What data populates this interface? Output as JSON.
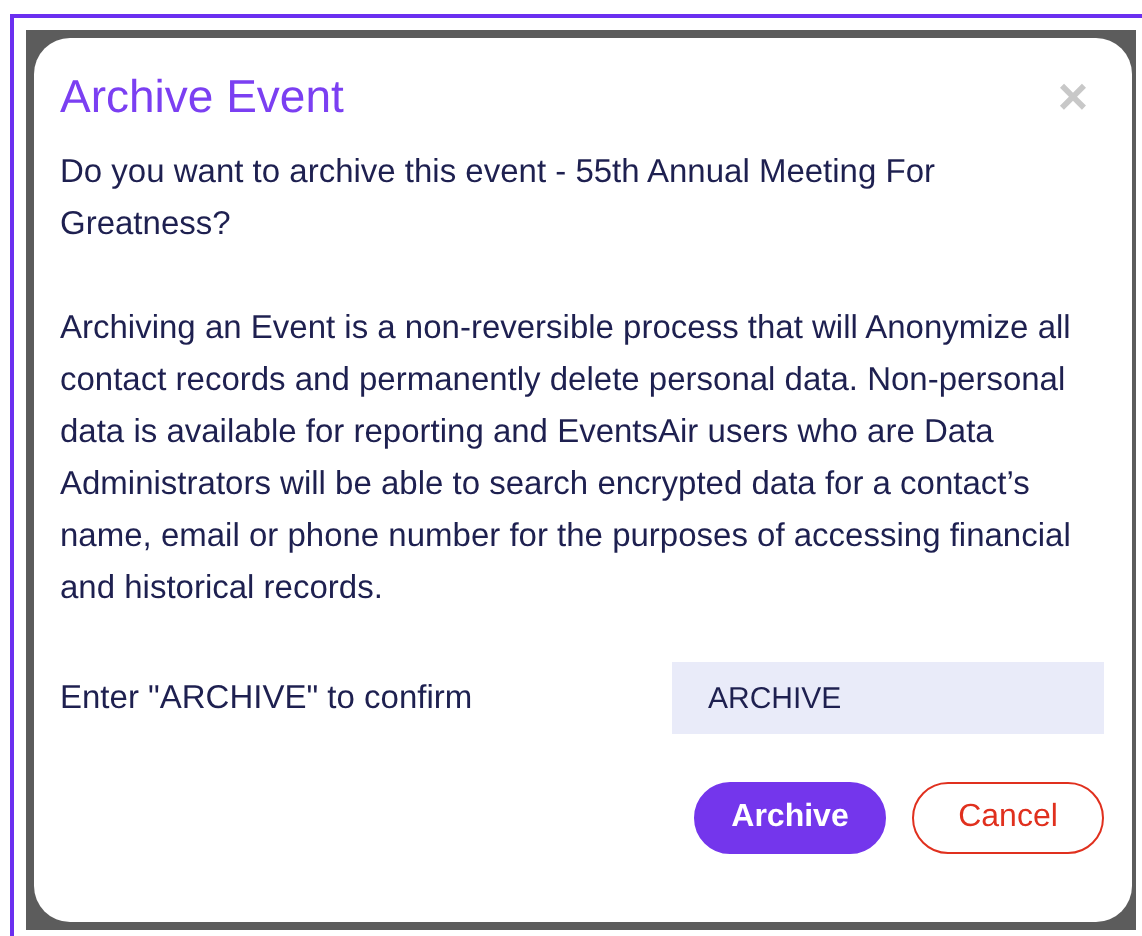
{
  "dialog": {
    "title": "Archive Event",
    "close": "×",
    "question": "Do you want to archive this event - 55th Annual Meeting For Greatness?",
    "description": "Archiving an Event is a non-reversible process that will Anonymize all contact records and permanently delete personal data. Non-personal data is available for reporting and EventsAir users who are Data Administrators will be able to search encrypted data for a contact’s name, email or phone number for the purposes of accessing financial and historical records.",
    "confirm_label": "Enter \"ARCHIVE\" to confirm",
    "confirm_value": "ARCHIVE",
    "buttons": [
      {
        "label": "Archive",
        "kind": "primary"
      },
      {
        "label": "Cancel",
        "kind": "secondary"
      }
    ]
  }
}
